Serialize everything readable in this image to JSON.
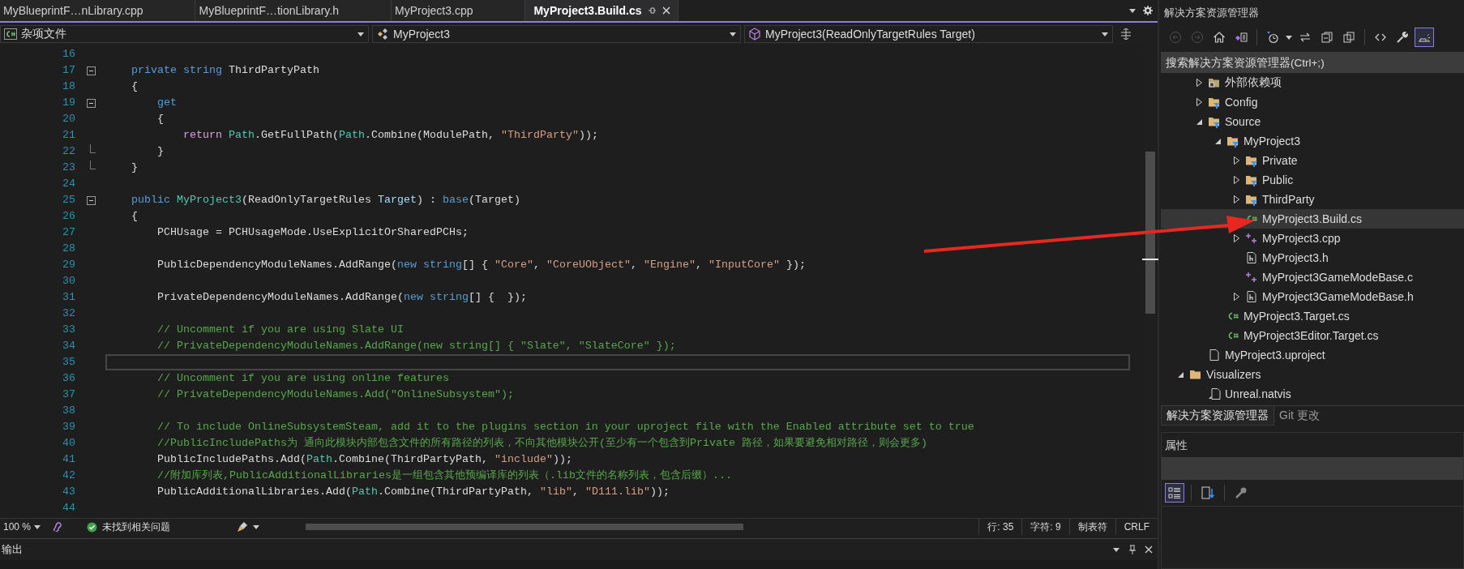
{
  "editor_tabs": [
    {
      "label": "MyBlueprintF…nLibrary.cpp",
      "selected": false
    },
    {
      "label": "MyBlueprintF…tionLibrary.h",
      "selected": false
    },
    {
      "label": "MyProject3.cpp",
      "selected": false
    },
    {
      "label": "MyProject3.Build.cs",
      "selected": true
    }
  ],
  "navigation_bar": [
    {
      "label": "杂项文件",
      "kind": "csharp"
    },
    {
      "label": "MyProject3",
      "kind": "project"
    },
    {
      "label": "MyProject3(ReadOnlyTargetRules Target)",
      "kind": "member"
    }
  ],
  "code": {
    "lines": [
      {
        "number": "16",
        "current": false,
        "collapsible": false,
        "block_end": false
      },
      {
        "number": "17",
        "current": false,
        "collapsible": true,
        "block_end": false,
        "tokens": [
          {
            "kind": "keyword",
            "text": "    private"
          },
          {
            "kind": "keyword",
            "text": " string"
          },
          {
            "kind": "plain",
            "text": " ThirdPartyPath"
          }
        ]
      },
      {
        "number": "18",
        "current": false,
        "collapsible": false,
        "block_end": false,
        "tokens": [
          {
            "kind": "plain",
            "text": "    {"
          }
        ]
      },
      {
        "number": "19",
        "current": false,
        "collapsible": true,
        "block_end": false,
        "tokens": [
          {
            "kind": "keyword",
            "text": "        get"
          }
        ]
      },
      {
        "number": "20",
        "current": false,
        "collapsible": false,
        "block_end": false,
        "tokens": [
          {
            "kind": "plain",
            "text": "        {"
          }
        ]
      },
      {
        "number": "21",
        "current": false,
        "collapsible": false,
        "block_end": false,
        "tokens": [
          {
            "kind": "control",
            "text": "            return "
          },
          {
            "kind": "type",
            "text": "Path"
          },
          {
            "kind": "plain",
            "text": ".GetFullPath("
          },
          {
            "kind": "type",
            "text": "Path"
          },
          {
            "kind": "plain",
            "text": ".Combine(ModulePath, "
          },
          {
            "kind": "string",
            "text": "\"ThirdParty\""
          },
          {
            "kind": "plain",
            "text": "));"
          }
        ]
      },
      {
        "number": "22",
        "current": false,
        "collapsible": false,
        "block_end": true,
        "tokens": [
          {
            "kind": "plain",
            "text": "        }"
          }
        ]
      },
      {
        "number": "23",
        "current": false,
        "collapsible": false,
        "block_end": true,
        "tokens": [
          {
            "kind": "plain",
            "text": "    }"
          }
        ]
      },
      {
        "number": "24",
        "current": false,
        "collapsible": false,
        "block_end": false
      },
      {
        "number": "25",
        "current": false,
        "collapsible": true,
        "block_end": false,
        "tokens": [
          {
            "kind": "keyword",
            "text": "    public "
          },
          {
            "kind": "type",
            "text": "MyProject3"
          },
          {
            "kind": "plain",
            "text": "(ReadOnlyTargetRules "
          },
          {
            "kind": "param",
            "text": "Target"
          },
          {
            "kind": "plain",
            "text": ") : "
          },
          {
            "kind": "keyword",
            "text": "base"
          },
          {
            "kind": "plain",
            "text": "(Target)"
          }
        ]
      },
      {
        "number": "26",
        "current": false,
        "collapsible": false,
        "block_end": false,
        "tokens": [
          {
            "kind": "plain",
            "text": "    {"
          }
        ]
      },
      {
        "number": "27",
        "current": false,
        "collapsible": false,
        "block_end": false,
        "tokens": [
          {
            "kind": "plain",
            "text": "        PCHUsage = PCHUsageMode.UseExplicitOrSharedPCHs;"
          }
        ]
      },
      {
        "number": "28",
        "current": false,
        "collapsible": false,
        "block_end": false
      },
      {
        "number": "29",
        "current": false,
        "collapsible": false,
        "block_end": false,
        "tokens": [
          {
            "kind": "plain",
            "text": "        PublicDependencyModuleNames.AddRange("
          },
          {
            "kind": "keyword",
            "text": "new"
          },
          {
            "kind": "keyword",
            "text": " string"
          },
          {
            "kind": "plain",
            "text": "[] { "
          },
          {
            "kind": "string",
            "text": "\"Core\""
          },
          {
            "kind": "plain",
            "text": ", "
          },
          {
            "kind": "string",
            "text": "\"CoreUObject\""
          },
          {
            "kind": "plain",
            "text": ", "
          },
          {
            "kind": "string",
            "text": "\"Engine\""
          },
          {
            "kind": "plain",
            "text": ", "
          },
          {
            "kind": "string",
            "text": "\"InputCore\""
          },
          {
            "kind": "plain",
            "text": " });"
          }
        ]
      },
      {
        "number": "30",
        "current": false,
        "collapsible": false,
        "block_end": false
      },
      {
        "number": "31",
        "current": false,
        "collapsible": false,
        "block_end": false,
        "tokens": [
          {
            "kind": "plain",
            "text": "        PrivateDependencyModuleNames.AddRange("
          },
          {
            "kind": "keyword",
            "text": "new"
          },
          {
            "kind": "keyword",
            "text": " string"
          },
          {
            "kind": "plain",
            "text": "[] {  });"
          }
        ]
      },
      {
        "number": "32",
        "current": false,
        "collapsible": false,
        "block_end": false
      },
      {
        "number": "33",
        "current": false,
        "collapsible": false,
        "block_end": false,
        "tokens": [
          {
            "kind": "comment",
            "text": "        // Uncomment if you are using Slate UI"
          }
        ]
      },
      {
        "number": "34",
        "current": false,
        "collapsible": false,
        "block_end": false,
        "tokens": [
          {
            "kind": "comment",
            "text": "        // PrivateDependencyModuleNames.AddRange(new string[] { \"Slate\", \"SlateCore\" });"
          }
        ]
      },
      {
        "number": "35",
        "current": true,
        "collapsible": false,
        "block_end": false
      },
      {
        "number": "36",
        "current": false,
        "collapsible": false,
        "block_end": false,
        "tokens": [
          {
            "kind": "comment",
            "text": "        // Uncomment if you are using online features"
          }
        ]
      },
      {
        "number": "37",
        "current": false,
        "collapsible": false,
        "block_end": false,
        "tokens": [
          {
            "kind": "comment",
            "text": "        // PrivateDependencyModuleNames.Add(\"OnlineSubsystem\");"
          }
        ]
      },
      {
        "number": "38",
        "current": false,
        "collapsible": false,
        "block_end": false
      },
      {
        "number": "39",
        "current": false,
        "collapsible": false,
        "block_end": false,
        "tokens": [
          {
            "kind": "comment",
            "text": "        // To include OnlineSubsystemSteam, add it to the plugins section in your uproject file with the Enabled attribute set to true"
          }
        ]
      },
      {
        "number": "40",
        "current": false,
        "collapsible": false,
        "block_end": false,
        "tokens": [
          {
            "kind": "comment",
            "text": "        //PublicIncludePaths为 通向此模块内部包含文件的所有路径的列表，不向其他模块公开(至少有一个包含到Private 路径，如果要避免相对路径，则会更多)"
          }
        ]
      },
      {
        "number": "41",
        "current": false,
        "collapsible": false,
        "block_end": false,
        "tokens": [
          {
            "kind": "plain",
            "text": "        PublicIncludePaths.Add("
          },
          {
            "kind": "type",
            "text": "Path"
          },
          {
            "kind": "plain",
            "text": ".Combine(ThirdPartyPath, "
          },
          {
            "kind": "string",
            "text": "\"include\""
          },
          {
            "kind": "plain",
            "text": "));"
          }
        ]
      },
      {
        "number": "42",
        "current": false,
        "collapsible": false,
        "block_end": false,
        "tokens": [
          {
            "kind": "comment",
            "text": "        //附加库列表,PublicAdditionalLibraries是一组包含其他预编译库的列表（.lib文件的名称列表，包含后缀）..."
          }
        ]
      },
      {
        "number": "43",
        "current": false,
        "collapsible": false,
        "block_end": false,
        "tokens": [
          {
            "kind": "plain",
            "text": "        PublicAdditionalLibraries.Add("
          },
          {
            "kind": "type",
            "text": "Path"
          },
          {
            "kind": "plain",
            "text": ".Combine(ThirdPartyPath, "
          },
          {
            "kind": "string",
            "text": "\"lib\""
          },
          {
            "kind": "plain",
            "text": ", "
          },
          {
            "kind": "string",
            "text": "\"D111.lib\""
          },
          {
            "kind": "plain",
            "text": "));"
          }
        ]
      },
      {
        "number": "44",
        "current": false,
        "collapsible": false,
        "block_end": false
      }
    ]
  },
  "status_bar": {
    "zoom": "100 %",
    "issues": "未找到相关问题",
    "line": "行: 35",
    "column": "字符: 9",
    "indent": "制表符",
    "line_ending": "CRLF"
  },
  "output_panel": {
    "title": "输出"
  },
  "solution_explorer": {
    "title": "解决方案资源管理器",
    "toolbar": [
      {
        "kind": "back",
        "selected": false,
        "disabled": true
      },
      {
        "kind": "forward",
        "selected": false,
        "disabled": true
      },
      {
        "kind": "home",
        "selected": false,
        "disabled": false
      },
      {
        "kind": "solution",
        "selected": false,
        "disabled": false
      },
      {
        "kind": "history",
        "selected": false,
        "disabled": false
      },
      {
        "kind": "sync",
        "selected": false,
        "disabled": false
      },
      {
        "kind": "collapse",
        "selected": false,
        "disabled": false
      },
      {
        "kind": "show-all",
        "selected": false,
        "disabled": false
      },
      {
        "kind": "code",
        "selected": false,
        "disabled": false
      },
      {
        "kind": "properties",
        "selected": false,
        "disabled": false
      },
      {
        "kind": "preview",
        "selected": true,
        "disabled": false
      }
    ],
    "search": {
      "placeholder": "搜索解决方案资源管理器(Ctrl+;)"
    },
    "tree": [
      {
        "children": [
          {
            "label": "外部依赖项",
            "kind": "external",
            "expanded": false,
            "selected": false
          },
          {
            "label": "Config",
            "kind": "filter-folder",
            "expanded": false,
            "selected": false
          },
          {
            "label": "Source",
            "kind": "filter-folder",
            "expanded": true,
            "selected": false,
            "children": [
              {
                "label": "MyProject3",
                "kind": "filter-folder",
                "expanded": true,
                "selected": false,
                "children": [
                  {
                    "label": "Private",
                    "kind": "filter-folder",
                    "expanded": false,
                    "selected": false
                  },
                  {
                    "label": "Public",
                    "kind": "filter-folder",
                    "expanded": false,
                    "selected": false
                  },
                  {
                    "label": "ThirdParty",
                    "kind": "filter-folder",
                    "expanded": false,
                    "selected": false
                  },
                  {
                    "label": "MyProject3.Build.cs",
                    "kind": "csharp",
                    "selected": true
                  },
                  {
                    "label": "MyProject3.cpp",
                    "kind": "cpp",
                    "expanded": false,
                    "selected": false
                  },
                  {
                    "label": "MyProject3.h",
                    "kind": "header",
                    "selected": false
                  },
                  {
                    "label": "MyProject3GameModeBase.c",
                    "kind": "cpp",
                    "selected": false
                  },
                  {
                    "label": "MyProject3GameModeBase.h",
                    "kind": "header",
                    "expanded": false,
                    "selected": false
                  }
                ]
              },
              {
                "label": "MyProject3.Target.cs",
                "kind": "csharp",
                "selected": false
              },
              {
                "label": "MyProject3Editor.Target.cs",
                "kind": "csharp",
                "selected": false
              }
            ]
          },
          {
            "label": "MyProject3.uproject",
            "kind": "file",
            "selected": false
          }
        ]
      },
      {
        "label": "Visualizers",
        "kind": "folder",
        "expanded": true,
        "selected": false,
        "children": [
          {
            "label": "Unreal.natvis",
            "kind": "natvis",
            "selected": false
          }
        ]
      }
    ],
    "tabs": [
      {
        "label": "解决方案资源管理器",
        "selected": true
      },
      {
        "label": "Git 更改",
        "selected": false
      }
    ]
  },
  "properties": {
    "title": "属性",
    "toolbar": [
      {
        "kind": "categorized",
        "selected": true
      },
      {
        "kind": "alphabetical",
        "selected": false
      },
      {
        "kind": "property-pages",
        "selected": false
      }
    ]
  }
}
